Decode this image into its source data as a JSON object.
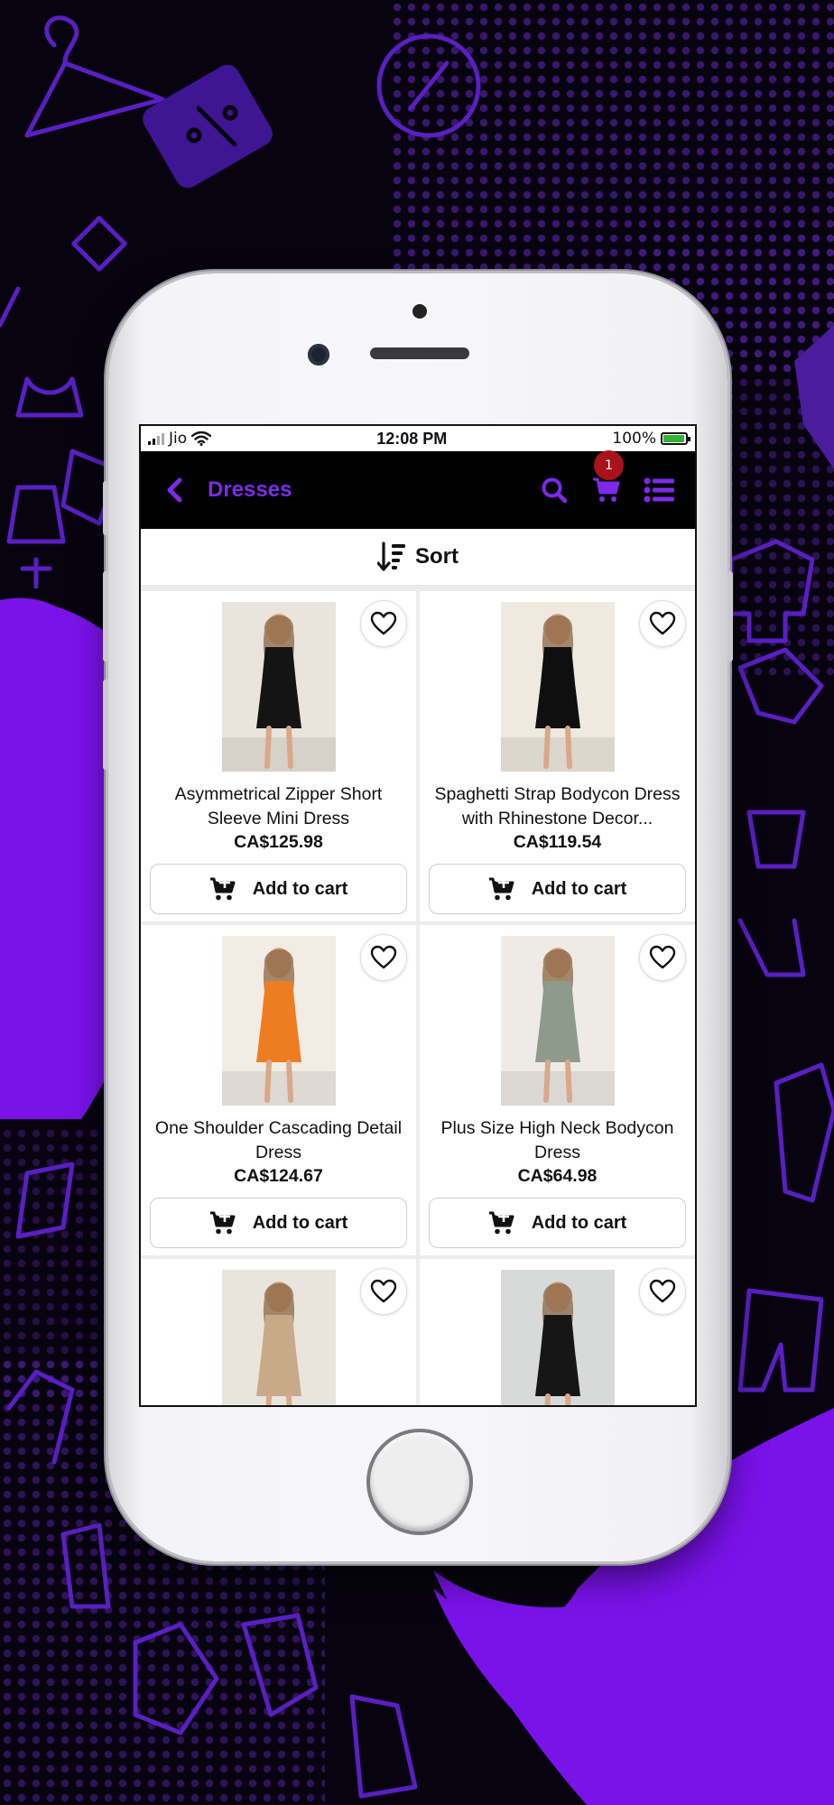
{
  "colors": {
    "accent": "#7d2ae8",
    "badge": "#a8131c",
    "background": "#07040f",
    "purple_wave": "#7a12ea"
  },
  "status_bar": {
    "carrier": "Jio",
    "time": "12:08 PM",
    "battery": "100%"
  },
  "header": {
    "title": "Dresses",
    "cart_count": "1",
    "icons": [
      "back-chevron-icon",
      "search-icon",
      "cart-icon",
      "list-menu-icon"
    ]
  },
  "sort": {
    "label": "Sort",
    "icon": "sort-icon"
  },
  "products": [
    {
      "name": "Asymmetrical Zipper Short Sleeve Mini Dress",
      "price": "CA$125.98",
      "button": "Add to cart",
      "dress_color": "#141414",
      "bg_color": "#e9e4dc"
    },
    {
      "name": "Spaghetti Strap Bodycon Dress with Rhinestone Decor...",
      "price": "CA$119.54",
      "button": "Add to cart",
      "dress_color": "#0f0f10",
      "bg_color": "#efe9df"
    },
    {
      "name": "One Shoulder Cascading Detail Dress",
      "price": "CA$124.67",
      "button": "Add to cart",
      "dress_color": "#ee7d22",
      "bg_color": "#f1ece4"
    },
    {
      "name": "Plus Size High Neck Bodycon Dress",
      "price": "CA$64.98",
      "button": "Add to cart",
      "dress_color": "#8e9a8c",
      "bg_color": "#eeebe6"
    },
    {
      "name": "",
      "price": "",
      "button": "",
      "dress_color": "#c8a988",
      "bg_color": "#eae5dc"
    },
    {
      "name": "",
      "price": "",
      "button": "",
      "dress_color": "#161616",
      "bg_color": "#d8dad9"
    }
  ]
}
